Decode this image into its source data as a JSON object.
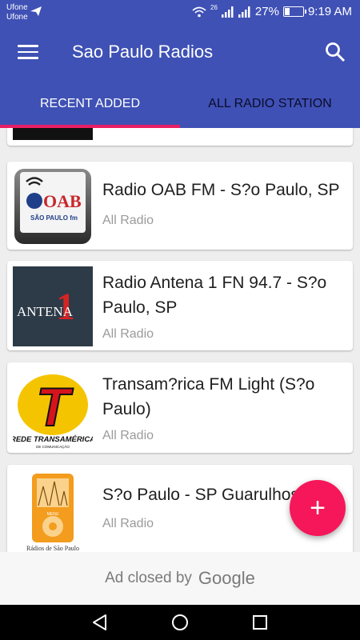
{
  "status_bar": {
    "carrier_1": "Ufone",
    "carrier_2": "Ufone",
    "network": "26",
    "battery_percent": "27%",
    "battery_level": 0.27,
    "time": "9:19 AM"
  },
  "app_bar": {
    "title": "Sao Paulo Radios"
  },
  "tabs": [
    {
      "label": "RECENT ADDED",
      "active": true
    },
    {
      "label": "ALL RADIO STATION",
      "active": false
    }
  ],
  "stations": [
    {
      "title": "Radio OAB FM - S?o Paulo, SP",
      "category": "All Radio",
      "logo_text": "OAB",
      "logo_sub": "SÃO PAULO fm"
    },
    {
      "title_line1": "Radio Antena 1 FN 94.7 - S?o",
      "title_line2": "Paulo, SP",
      "category": "All Radio",
      "logo_text": "ANTENA",
      "logo_num": "1"
    },
    {
      "title_line1": "Transam?rica FM Light (S?o",
      "title_line2": "Paulo)",
      "category": "All Radio",
      "logo_text": "REDE TRANSAMÉRICA",
      "logo_sub": "DE COMUNICAÇÃO",
      "logo_letter": "T"
    },
    {
      "title": "S?o Paulo - SP Guarulhos",
      "category": "All Radio",
      "logo_menu": "MENU",
      "logo_sub": "Rádios de São Paulo"
    }
  ],
  "fab": {
    "label": "+"
  },
  "ad": {
    "text": "Ad closed by",
    "brand": "Google"
  },
  "colors": {
    "primary": "#3f51b5",
    "accent": "#e91e63",
    "fab": "#f5175a"
  }
}
